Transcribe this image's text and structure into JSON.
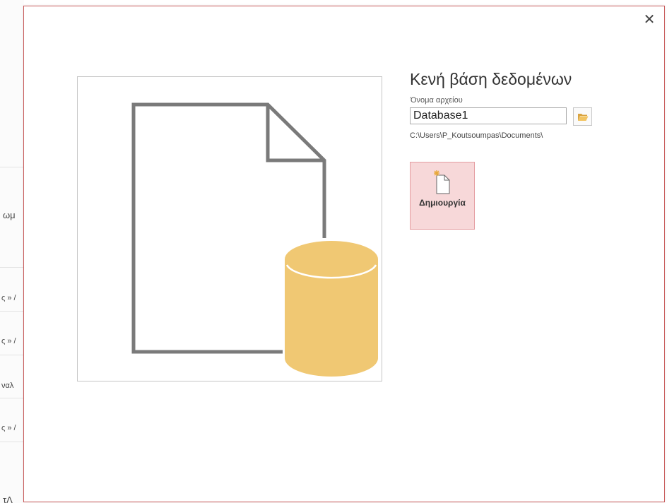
{
  "background": {
    "fragments": [
      "ωμ",
      "ς » /",
      "ς » /",
      "ναλ",
      "ς » /",
      "τΛ"
    ]
  },
  "dialog": {
    "close_icon": "close-icon",
    "title": "Κενή βάση δεδομένων",
    "file_name_label": "Όνομα αρχείου",
    "file_name_value": "Database1",
    "browse_icon": "folder-open-icon",
    "file_path": "C:\\Users\\P_Koutsoumpas\\Documents\\",
    "create_button_label": "Δημιουργία",
    "create_icon": "new-file-sparkle-icon",
    "preview_icon": "blank-database-icon"
  },
  "colors": {
    "accent_border": "#c85a5a",
    "create_bg": "#f7d8d9",
    "database_fill": "#f0c873",
    "doc_stroke": "#7a7a7a"
  }
}
